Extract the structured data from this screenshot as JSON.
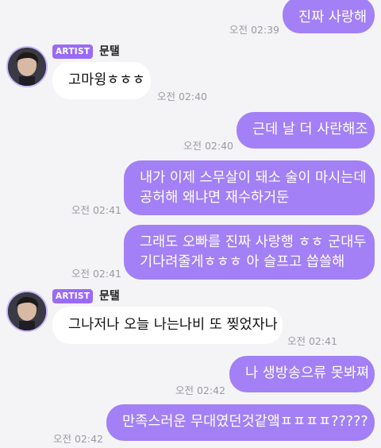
{
  "accent_color": "#a380f5",
  "badge_color": "#9a6bf7",
  "messages": [
    {
      "text": "진짜 사랑해",
      "time": "오전 02:39"
    },
    {
      "artist_badge": "ARTIST",
      "sender": "문탤",
      "text": "고마윙ㅎㅎㅎ",
      "time": "오전 02:40"
    },
    {
      "text": "근데 날 더 사란해조",
      "time": "오전 02:40"
    },
    {
      "line1": "내가 이제 스무살이 돼소 술이 마시는데",
      "line2": "공허해 왜냐면 재수하거둔",
      "time": "오전 02:41"
    },
    {
      "line1": "그래도 오빠를 진짜 사랑행 ㅎㅎ 군대두",
      "line2": "기다려줄게ㅎㅎㅎ 아 슬프고 씁쓸해",
      "time": "오전 02:41"
    },
    {
      "artist_badge": "ARTIST",
      "sender": "문탤",
      "text": "그나저나 오늘 나는나비 또 찢었자나",
      "time": "오전 02:41"
    },
    {
      "text": "나 생방송으류 못봐쪄",
      "time": "오전 02:42"
    },
    {
      "text": "만족스러운 무대였던것같앸ㅍㅍㅍㅍ?????",
      "time": "오전 02:42"
    }
  ]
}
